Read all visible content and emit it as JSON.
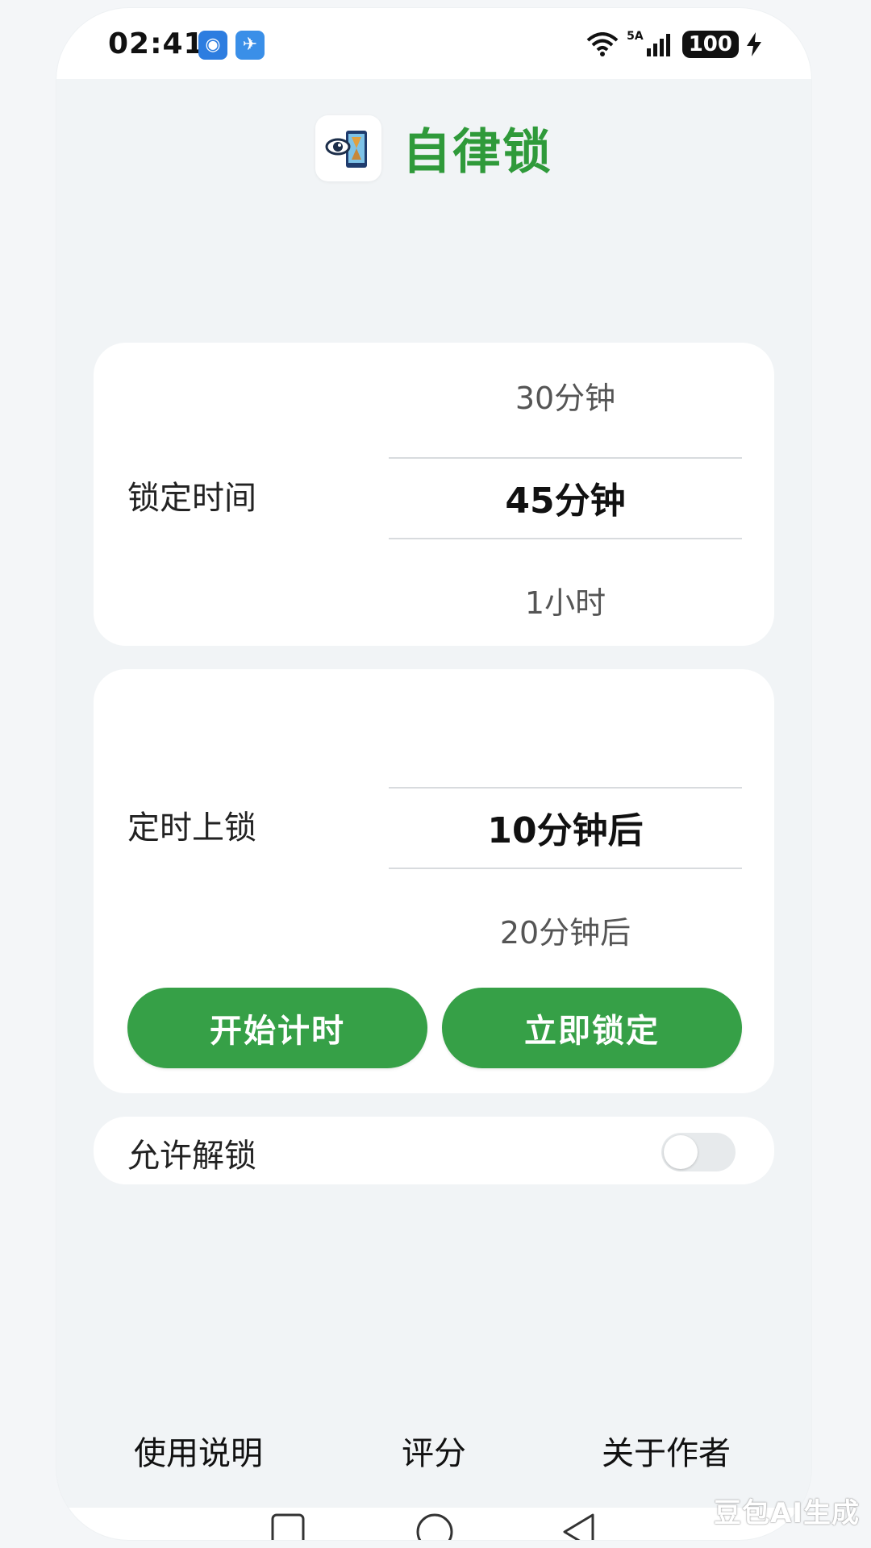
{
  "status_bar": {
    "time": "02:41",
    "network_label": "5A",
    "battery": "100"
  },
  "header": {
    "title": "自律锁"
  },
  "lock_duration": {
    "label": "锁定时间",
    "options": [
      "30分钟",
      "45分钟",
      "1小时"
    ],
    "selected": "45分钟"
  },
  "timed_lock": {
    "label": "定时上锁",
    "options": [
      "10分钟后",
      "20分钟后"
    ],
    "selected": "10分钟后",
    "start_button": "开始计时",
    "lock_now_button": "立即锁定"
  },
  "allow_unlock": {
    "label": "允许解锁",
    "enabled": false
  },
  "footer": {
    "instructions": "使用说明",
    "rate": "评分",
    "about": "关于作者"
  },
  "watermark": "豆包AI生成",
  "colors": {
    "accent": "#36a047",
    "title_green": "#2f9a3a",
    "background": "#f1f4f6"
  }
}
